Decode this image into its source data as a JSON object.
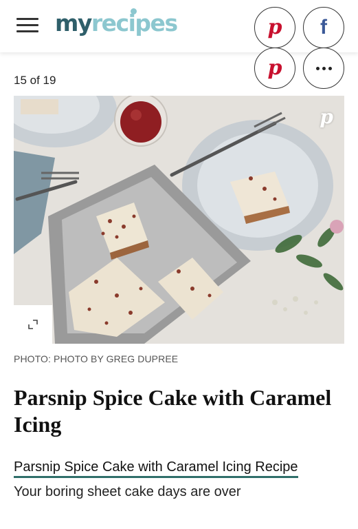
{
  "header": {
    "logo_my": "my",
    "logo_recipes": "recipes",
    "menu_icon": "hamburger-menu-icon",
    "pinterest_icon": "pinterest-icon",
    "facebook_icon": "facebook-icon",
    "brand_color": "#2f5f6a",
    "brand_accent": "#8cc7cf"
  },
  "slideshow": {
    "counter": "15 of 19",
    "share_more_icon": "more-options-icon",
    "photo_description": "",
    "expand_icon": "expand-icon",
    "credit": "PHOTO: PHOTO BY GREG DUPREE"
  },
  "slide": {
    "title": "Parsnip Spice Cake with Caramel Icing",
    "link_text": "Parsnip Spice Cake with Caramel Icing Recipe",
    "description": "Your boring sheet cake days are over",
    "link_underline_color": "#2f6f6a"
  },
  "colors": {
    "pinterest": "#c8102e",
    "facebook": "#3b5998"
  }
}
